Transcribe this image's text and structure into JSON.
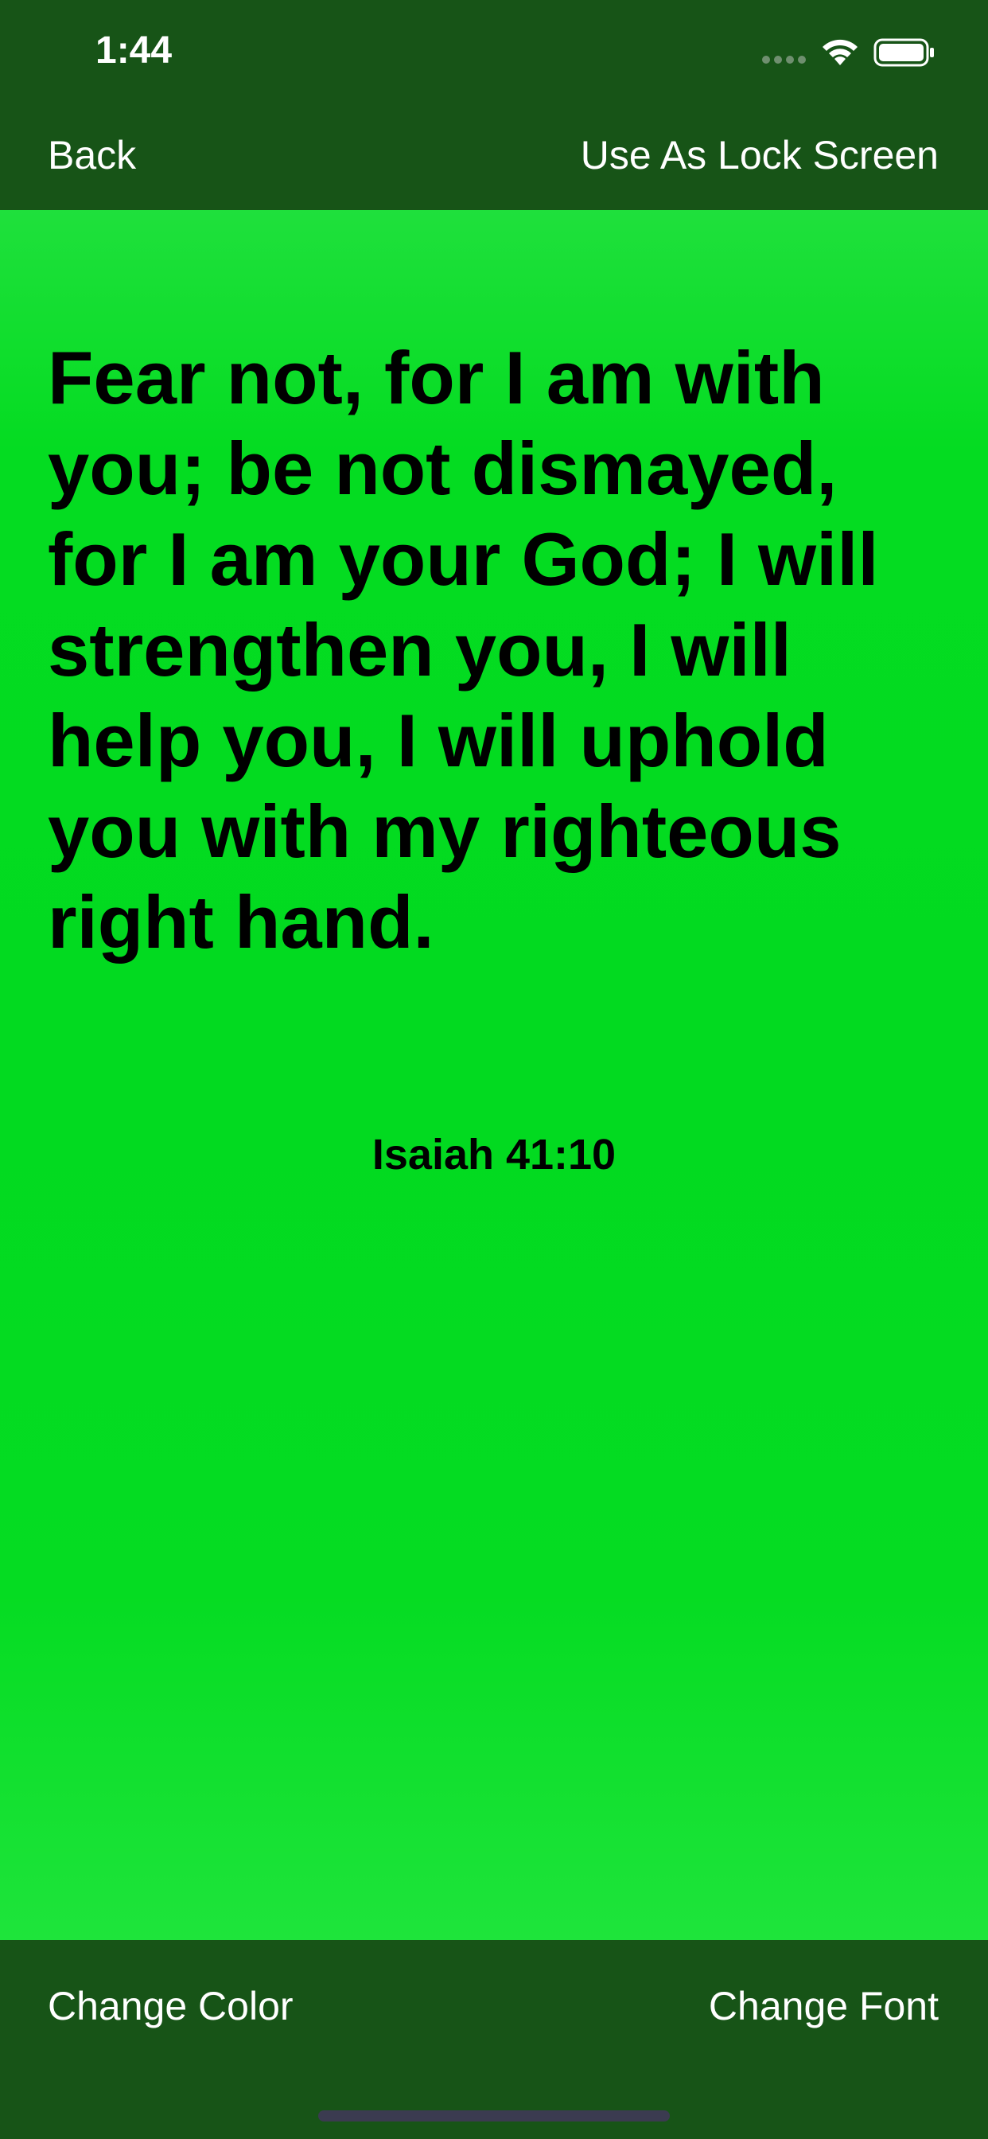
{
  "status_bar": {
    "time": "1:44"
  },
  "nav": {
    "back_label": "Back",
    "lock_screen_label": "Use As Lock Screen"
  },
  "verse": {
    "text": "Fear not, for I am with you; be not dismayed, for I am your God; I will strengthen you, I will help you, I will uphold you with my righteous right hand.",
    "reference": "Isaiah 41:10"
  },
  "toolbar": {
    "change_color_label": "Change Color",
    "change_font_label": "Change Font"
  },
  "colors": {
    "bar_background": "#175417",
    "wallpaper_green": "#02da20",
    "text_on_bar": "#ffffff",
    "verse_text": "#000000"
  },
  "icons": [
    "signal-dots-icon",
    "wifi-icon",
    "battery-icon"
  ]
}
